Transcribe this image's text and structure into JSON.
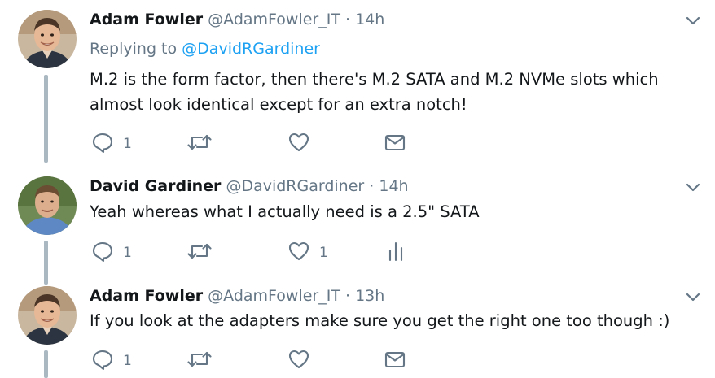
{
  "tweets": [
    {
      "name": "Adam Fowler",
      "handle": "@AdamFowler_IT",
      "separator": "·",
      "time": "14h",
      "replying_prefix": "Replying to",
      "replying_to": "@DavidRGardiner",
      "text": "M.2 is the form factor, then there's M.2 SATA and M.2 NVMe slots which almost look identical except for an extra notch!",
      "reply_count": "1",
      "like_count": "",
      "extra_action_icon": "mail-icon"
    },
    {
      "name": "David Gardiner",
      "handle": "@DavidRGardiner",
      "separator": "·",
      "time": "14h",
      "text": "Yeah whereas what I actually need is a 2.5\" SATA",
      "reply_count": "1",
      "like_count": "1",
      "extra_action_icon": "analytics-icon"
    },
    {
      "name": "Adam Fowler",
      "handle": "@AdamFowler_IT",
      "separator": "·",
      "time": "13h",
      "text": "If you look at the adapters make sure you get the right one too though :)",
      "reply_count": "1",
      "like_count": "",
      "extra_action_icon": "mail-icon"
    }
  ],
  "colors": {
    "text": "#14171a",
    "secondary": "#657786",
    "link": "#1da1f2",
    "thread_line": "#aab8c2",
    "action_icon": "#657786"
  }
}
